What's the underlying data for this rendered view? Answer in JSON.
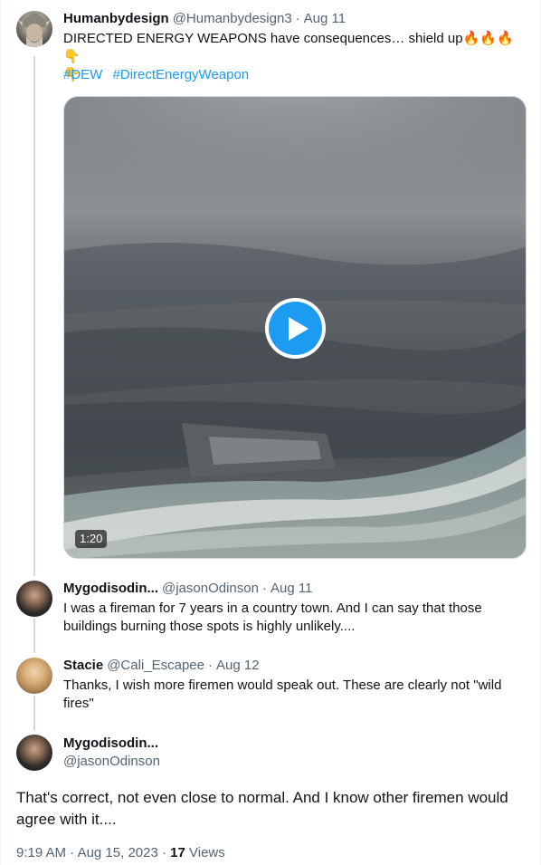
{
  "thread": [
    {
      "author_name": "Humanbydesign",
      "handle": "@Humanbydesign3",
      "separator": "·",
      "date": "Aug 11",
      "text": "DIRECTED ENERGY WEAPONS have consequences… shield up",
      "emojis": [
        "fire-emoji",
        "fire-emoji",
        "fire-emoji",
        "point-down-emoji",
        "point-down-emoji"
      ],
      "hashtags": [
        "#DEW",
        "#DirectEnergyWeapon"
      ],
      "video": {
        "duration": "1:20",
        "play_icon": "play-icon"
      }
    },
    {
      "author_name": "Mygodisodin...",
      "handle": "@jasonOdinson",
      "separator": "·",
      "date": "Aug 11",
      "text": "I was a fireman for 7 years in a country town. And I can say that those buildings burning those spots is highly unlikely...."
    },
    {
      "author_name": "Stacie",
      "handle": "@Cali_Escapee",
      "separator": "·",
      "date": "Aug 12",
      "text": "Thanks, I wish more firemen would speak out. These are clearly not \"wild fires\""
    }
  ],
  "main_tweet": {
    "author_name": "Mygodisodin...",
    "handle": "@jasonOdinson",
    "text": "That's correct, not even close to normal. And I know other firemen would agree with it....",
    "time": "9:19 AM",
    "separator": "·",
    "date": "Aug 15, 2023",
    "views_count": "17",
    "views_label": "Views"
  },
  "colors": {
    "accent": "#1d9bf0",
    "text_primary": "#0f1419",
    "text_secondary": "#536471",
    "thread_line": "#cfd9de"
  }
}
